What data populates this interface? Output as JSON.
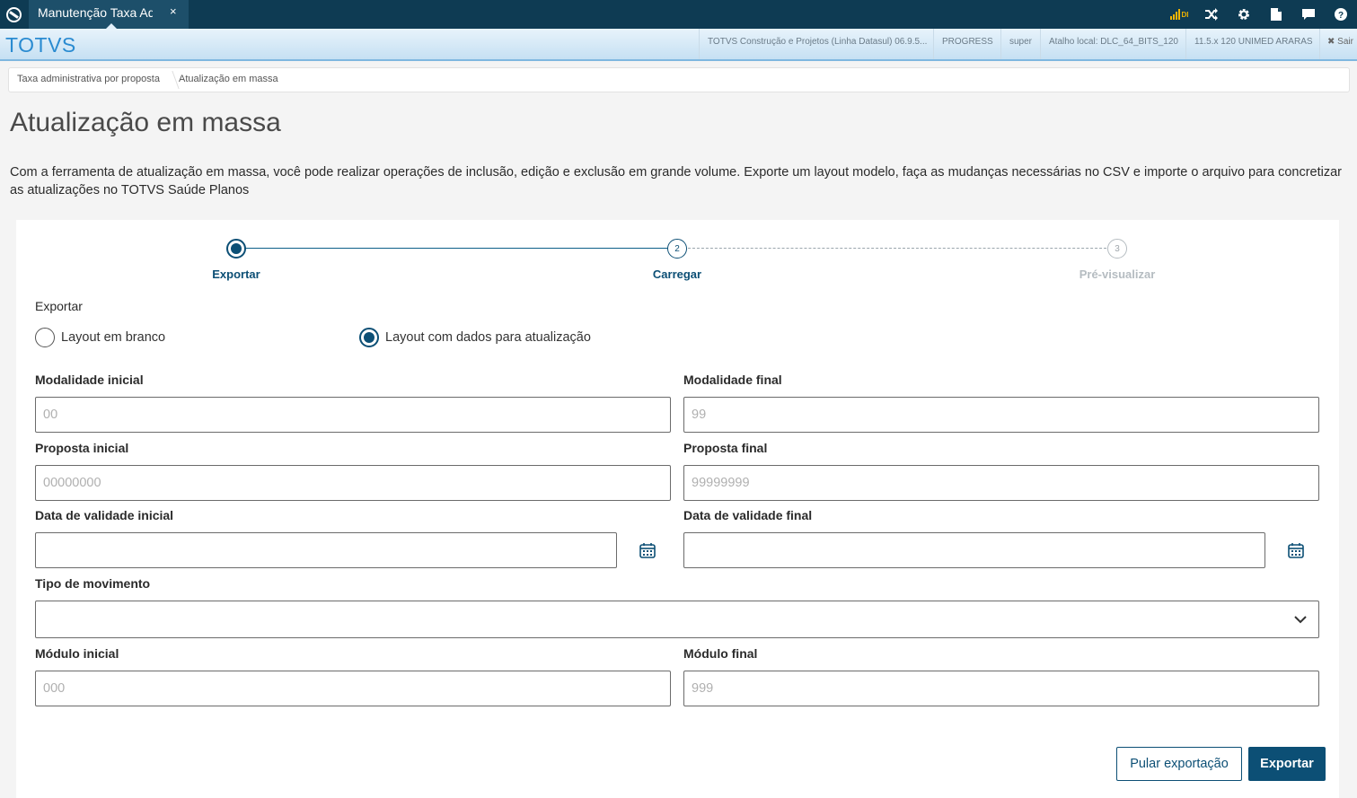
{
  "app": {
    "tab_title": "Manutenção Taxa Adm",
    "tab_close": "×",
    "brand": "TOTVS",
    "signal_text": "DI",
    "header_info": [
      "TOTVS Construção e Projetos (Linha Datasul) 06.9.5...",
      "PROGRESS",
      "super",
      "Atalho local: DLC_64_BITS_120",
      "11.5.x 120 UNIMED ARARAS"
    ],
    "logout_label": "✖ Sair"
  },
  "breadcrumb": {
    "items": [
      "Taxa administrativa por proposta",
      "Atualização em massa"
    ]
  },
  "page": {
    "title": "Atualização em massa",
    "description": "Com a ferramenta de atualização em massa, você pode realizar operações de inclusão, edição e exclusão em grande volume. Exporte um layout modelo, faça as mudanças necessárias no CSV e importe o arquivo para concretizar as atualizações no TOTVS Saúde Planos"
  },
  "stepper": {
    "steps": [
      {
        "label": "Exportar",
        "number": "1",
        "state": "active"
      },
      {
        "label": "Carregar",
        "number": "2",
        "state": "next"
      },
      {
        "label": "Pré-visualizar",
        "number": "3",
        "state": "disabled"
      }
    ]
  },
  "form": {
    "section_title": "Exportar",
    "radio_options": [
      {
        "label": "Layout em branco",
        "selected": false
      },
      {
        "label": "Layout com dados para atualização",
        "selected": true
      }
    ],
    "modalidade_inicial": {
      "label": "Modalidade inicial",
      "placeholder": "00",
      "value": ""
    },
    "modalidade_final": {
      "label": "Modalidade final",
      "placeholder": "99",
      "value": ""
    },
    "proposta_inicial": {
      "label": "Proposta inicial",
      "placeholder": "00000000",
      "value": ""
    },
    "proposta_final": {
      "label": "Proposta final",
      "placeholder": "99999999",
      "value": ""
    },
    "data_validade_inicial": {
      "label": "Data de validade inicial",
      "placeholder": "",
      "value": ""
    },
    "data_validade_final": {
      "label": "Data de validade final",
      "placeholder": "",
      "value": ""
    },
    "tipo_movimento": {
      "label": "Tipo de movimento",
      "value": ""
    },
    "modulo_inicial": {
      "label": "Módulo inicial",
      "placeholder": "000",
      "value": ""
    },
    "modulo_final": {
      "label": "Módulo final",
      "placeholder": "999",
      "value": ""
    }
  },
  "actions": {
    "skip_label": "Pular exportação",
    "export_label": "Exportar"
  },
  "colors": {
    "primary": "#0c4f75",
    "topbar": "#0e3b53",
    "brand": "#2a8bd1"
  },
  "icons": [
    "app-logo-icon",
    "close-icon",
    "signal-icon",
    "shuffle-icon",
    "gear-icon",
    "document-icon",
    "chat-icon",
    "help-icon",
    "calendar-icon",
    "chevron-down-icon"
  ]
}
